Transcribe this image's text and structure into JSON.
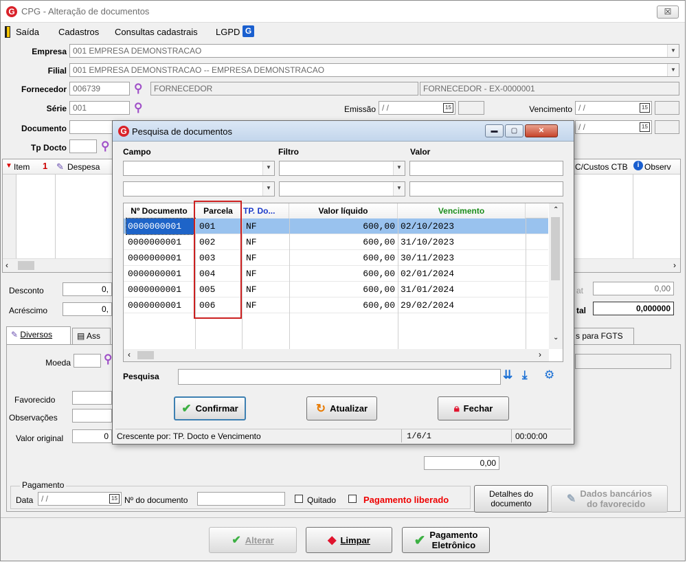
{
  "window": {
    "title": "CPG - Alteração de documentos",
    "close_label": "☒"
  },
  "menu": {
    "items": [
      "Saída",
      "Cadastros",
      "Consultas cadastrais",
      "LGPD"
    ]
  },
  "form": {
    "empresa_label": "Empresa",
    "empresa_value": "001 EMPRESA DEMONSTRACAO",
    "filial_label": "Filial",
    "filial_value": "001 EMPRESA DEMONSTRACAO -- EMPRESA DEMONSTRACAO",
    "fornecedor_label": "Fornecedor",
    "fornecedor_code": "006739",
    "fornecedor_name": "FORNECEDOR",
    "fornecedor_desc": "FORNECEDOR - EX-0000001",
    "serie_label": "Série",
    "serie_value": "001",
    "emissao_label": "Emissão",
    "emissao_value": "/ /",
    "vencimento_label": "Vencimento",
    "vencimento_value": "/ /",
    "documento_label": "Documento",
    "documento_date": "/ /",
    "tpdocto_label": "Tp Docto"
  },
  "items_grid": {
    "col_item": "Item",
    "col_item_num": "1",
    "col_despesa": "Despesa",
    "col_ccustos": "C/Custos CTB",
    "col_observ": "Observ"
  },
  "totals": {
    "desconto_label": "Desconto",
    "desconto_value": "0,",
    "acrescimo_label": "Acréscimo",
    "acrescimo_value": "0,",
    "right_label1": "at",
    "right_value1": "0,00",
    "total_label": "tal",
    "total_value": "0,000000"
  },
  "tabs": {
    "diversos": "Diversos",
    "assoc": "Ass",
    "fgts": "s para FGTS"
  },
  "diversos": {
    "moeda_label": "Moeda",
    "favorecido_label": "Favorecido",
    "observacoes_label": "Observações",
    "valor_original_label": "Valor original",
    "valor_original_value": "0",
    "extra_value": "0,00"
  },
  "pagamento": {
    "legend": "Pagamento",
    "data_label": "Data",
    "data_value": "/ /",
    "ndoc_label": "Nº do documento",
    "quitado_label": "Quitado",
    "liberado_label": "Pagamento liberado",
    "detalhes_line1": "Detalhes do",
    "detalhes_line2": "documento",
    "dados_line1": "Dados bancários",
    "dados_line2": "do favorecido"
  },
  "bottom_buttons": {
    "alterar": "Alterar",
    "limpar": "Limpar",
    "pagamento_line1": "Pagamento",
    "pagamento_line2": "Eletrônico"
  },
  "dialog": {
    "title": "Pesquisa de documentos",
    "campo_label": "Campo",
    "filtro_label": "Filtro",
    "valor_label": "Valor",
    "columns": [
      "Nº Documento",
      "Parcela",
      "TP. Do...",
      "Valor líquido",
      "Vencimento"
    ],
    "rows": [
      {
        "documento": "0000000001",
        "parcela": "001",
        "tp": "NF",
        "valor": "600,00",
        "vencimento": "02/10/2023"
      },
      {
        "documento": "0000000001",
        "parcela": "002",
        "tp": "NF",
        "valor": "600,00",
        "vencimento": "31/10/2023"
      },
      {
        "documento": "0000000001",
        "parcela": "003",
        "tp": "NF",
        "valor": "600,00",
        "vencimento": "30/11/2023"
      },
      {
        "documento": "0000000001",
        "parcela": "004",
        "tp": "NF",
        "valor": "600,00",
        "vencimento": "02/01/2024"
      },
      {
        "documento": "0000000001",
        "parcela": "005",
        "tp": "NF",
        "valor": "600,00",
        "vencimento": "31/01/2024"
      },
      {
        "documento": "0000000001",
        "parcela": "006",
        "tp": "NF",
        "valor": "600,00",
        "vencimento": "29/02/2024"
      }
    ],
    "pesquisa_label": "Pesquisa",
    "confirmar_label": "Confirmar",
    "atualizar_label": "Atualizar",
    "fechar_label": "Fechar",
    "status_sort": "Crescente por: TP. Docto e Vencimento",
    "status_count": "1/6/1",
    "status_time": "00:00:00"
  },
  "colors": {
    "accent_red": "#d9222a",
    "selection_blue": "#99c2ee",
    "vencimento_header": "#1a8c1a",
    "tp_header": "#1a39c9",
    "highlight_box": "#cc1f1f"
  }
}
